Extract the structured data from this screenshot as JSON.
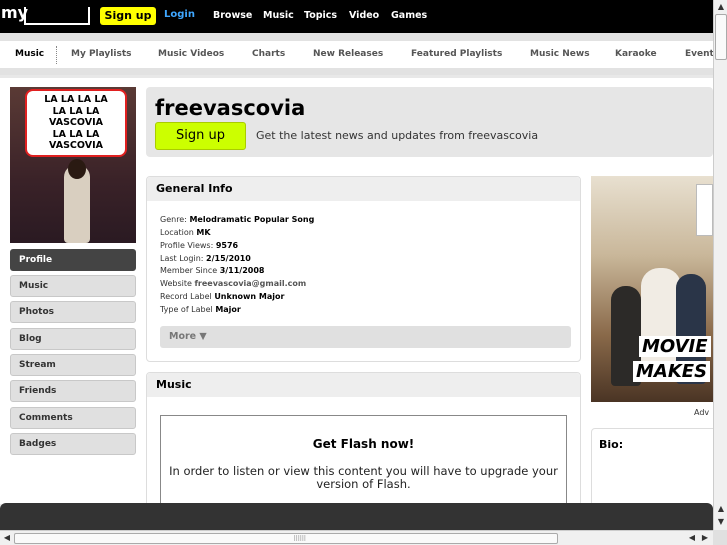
{
  "topbar": {
    "logo_text": "my",
    "signup_label": "Sign up",
    "login_label": "Login",
    "nav": [
      "Browse",
      "Music",
      "Topics",
      "Video",
      "Games"
    ]
  },
  "tabs": [
    "Music",
    "My Playlists",
    "Music Videos",
    "Charts",
    "New Releases",
    "Featured Playlists",
    "Music News",
    "Karaoke",
    "Event"
  ],
  "active_tab": "Music",
  "profile": {
    "name": "freevascovia",
    "signup_label": "Sign up",
    "tagline": "Get the latest news and updates from freevascovia",
    "image_caption": [
      "LA LA LA LA",
      "LA LA LA",
      "VASCOVIA",
      "LA LA LA",
      "VASCOVIA"
    ]
  },
  "sidebar": {
    "items": [
      "Profile",
      "Music",
      "Photos",
      "Blog",
      "Stream",
      "Friends",
      "Comments",
      "Badges"
    ],
    "active": "Profile"
  },
  "general_info": {
    "title": "General Info",
    "rows": [
      {
        "label": "Genre:",
        "value": "Melodramatic Popular Song"
      },
      {
        "label": "Location",
        "value": "MK"
      },
      {
        "label": "Profile Views:",
        "value": "9576"
      },
      {
        "label": "Last Login:",
        "value": "2/15/2010"
      },
      {
        "label": "Member Since",
        "value": "3/11/2008"
      },
      {
        "label": "Website",
        "value": "freevascovia@gmail.com"
      },
      {
        "label": "Record Label",
        "value": "Unknown Major"
      },
      {
        "label": "Type of Label",
        "value": "Major"
      }
    ],
    "more_label": "More ▼"
  },
  "music_panel": {
    "title": "Music",
    "flash_title": "Get Flash now!",
    "flash_message": "In order to listen or view this content you will have to upgrade your version of Flash."
  },
  "ad": {
    "text_line1": "MOVIE",
    "text_line2": "MAKES",
    "label": "Adv"
  },
  "bio": {
    "title": "Bio:"
  },
  "colors": {
    "topbar_bg": "#000000",
    "signup_yellow": "#ffff00",
    "signup_main_green": "#ccff00",
    "login_blue": "#3fa7ff",
    "sidebar_active": "#444444"
  },
  "icons": {
    "scroll_up": "▲",
    "scroll_down": "▼",
    "scroll_left": "◀",
    "scroll_right": "▶",
    "grip": "⠿⠿⠿"
  }
}
